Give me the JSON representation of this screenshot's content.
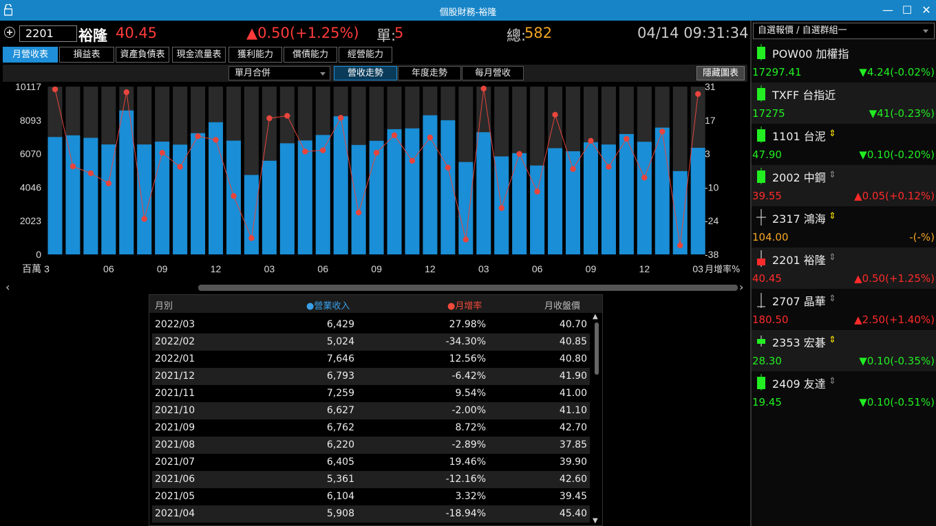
{
  "window": {
    "title": "個股財務-裕隆"
  },
  "header": {
    "code": "2201",
    "name": "裕隆",
    "price": "40.45",
    "change": "▲0.50(+1.25%)",
    "single_label": "單:",
    "single_value": "5",
    "total_label": "總:",
    "total_value": "582",
    "datetime": "04/14 09:31:34"
  },
  "tabs": [
    "月營收表",
    "損益表",
    "資產負債表",
    "現金流量表",
    "獲利能力",
    "償債能力",
    "經營能力"
  ],
  "toolbar": {
    "select_value": "單月合併",
    "view_buttons": [
      "營收走勢",
      "年度走勢",
      "每月營收"
    ],
    "hide_chart": "隱藏圖表"
  },
  "chart_data": {
    "type": "bar+line",
    "unit_left": "百萬",
    "unit_right": "月增率%",
    "y_left_ticks": [
      "10117",
      "8093",
      "6070",
      "4046",
      "2023",
      "0"
    ],
    "y_right_ticks": [
      "31",
      "17",
      "3",
      "-10",
      "-24",
      "-38"
    ],
    "ylim_left": [
      0,
      10117
    ],
    "ylim_right": [
      -38,
      31
    ],
    "x_tick_labels": [
      "3",
      "06",
      "09",
      "12",
      "03",
      "06",
      "09",
      "12",
      "03",
      "06",
      "09",
      "12",
      "03"
    ],
    "x_tick_index": [
      0,
      3,
      6,
      9,
      12,
      15,
      18,
      21,
      24,
      27,
      30,
      33,
      36
    ],
    "series": [
      {
        "name": "營業收入",
        "values": [
          7080,
          7180,
          7030,
          6630,
          8680,
          6630,
          6800,
          6620,
          7310,
          7970,
          6860,
          4790,
          5650,
          6700,
          6870,
          7200,
          8330,
          6600,
          6850,
          7550,
          7600,
          8390,
          8090,
          5570,
          7370,
          5908,
          6104,
          5361,
          6405,
          6220,
          6762,
          6627,
          7259,
          6793,
          7646,
          5024,
          6429
        ]
      },
      {
        "name": "月增率",
        "values": [
          29.9,
          -1.8,
          -4.6,
          -8.8,
          28.7,
          -23.4,
          3.8,
          -2.0,
          10.6,
          9.1,
          -14.0,
          -31.3,
          18.0,
          19.0,
          4.3,
          4.8,
          18.2,
          -20.8,
          3.8,
          11.0,
          0.5,
          10.1,
          -2.3,
          -31.9,
          30.2,
          -18.94,
          3.32,
          -12.16,
          19.46,
          -2.89,
          8.72,
          -2.0,
          9.54,
          -6.42,
          12.56,
          -34.3,
          27.98
        ]
      }
    ]
  },
  "table": {
    "headers": [
      "月別",
      "●營業收入",
      "●月增率",
      "月收盤價"
    ],
    "rows": [
      [
        "2022/03",
        "6,429",
        "27.98%",
        "40.70"
      ],
      [
        "2022/02",
        "5,024",
        "-34.30%",
        "40.85"
      ],
      [
        "2022/01",
        "7,646",
        "12.56%",
        "40.80"
      ],
      [
        "2021/12",
        "6,793",
        "-6.42%",
        "41.90"
      ],
      [
        "2021/11",
        "7,259",
        "9.54%",
        "41.00"
      ],
      [
        "2021/10",
        "6,627",
        "-2.00%",
        "41.10"
      ],
      [
        "2021/09",
        "6,762",
        "8.72%",
        "42.70"
      ],
      [
        "2021/08",
        "6,220",
        "-2.89%",
        "37.85"
      ],
      [
        "2021/07",
        "6,405",
        "19.46%",
        "39.90"
      ],
      [
        "2021/06",
        "5,361",
        "-12.16%",
        "42.60"
      ],
      [
        "2021/05",
        "6,104",
        "3.32%",
        "39.45"
      ],
      [
        "2021/04",
        "5,908",
        "-18.94%",
        "45.40"
      ]
    ]
  },
  "watchlist": {
    "group": "自選報價 / 自選群組一",
    "colors": {
      "up": "#ff2a2a",
      "down": "#22ee22",
      "flat": "#f5a623",
      "flag": "#ffe600",
      "flag_gray": "#888888"
    },
    "items": [
      {
        "name": "POW00 加權指",
        "price": "17297.41",
        "change": "▼4.24(-0.02%)",
        "dir": "down",
        "candle": "green",
        "flag": ""
      },
      {
        "name": "TXFF 台指近",
        "price": "17275",
        "change": "▼41(-0.23%)",
        "dir": "down",
        "candle": "green",
        "flag": ""
      },
      {
        "name": "1101 台泥",
        "price": "47.90",
        "change": "▼0.10(-0.20%)",
        "dir": "down",
        "candle": "green",
        "flag": "yellow"
      },
      {
        "name": "2002 中鋼",
        "price": "39.55",
        "change": "▲0.05(+0.12%)",
        "dir": "up",
        "candle": "green",
        "flag": "gray"
      },
      {
        "name": "2317 鴻海",
        "price": "104.00",
        "change": "-(-%)",
        "dir": "flat",
        "candle": "cross",
        "flag": "yellow"
      },
      {
        "name": "2201 裕隆",
        "price": "40.45",
        "change": "▲0.50(+1.25%)",
        "dir": "up",
        "candle": "red",
        "flag": "gray"
      },
      {
        "name": "2707 晶華",
        "price": "180.50",
        "change": "▲2.50(+1.40%)",
        "dir": "up",
        "candle": "line",
        "flag": "gray"
      },
      {
        "name": "2353 宏碁",
        "price": "28.30",
        "change": "▼0.10(-0.35%)",
        "dir": "down",
        "candle": "small-green",
        "flag": "yellow"
      },
      {
        "name": "2409 友達",
        "price": "19.45",
        "change": "▼0.10(-0.51%)",
        "dir": "down",
        "candle": "green",
        "flag": "gray"
      }
    ]
  }
}
